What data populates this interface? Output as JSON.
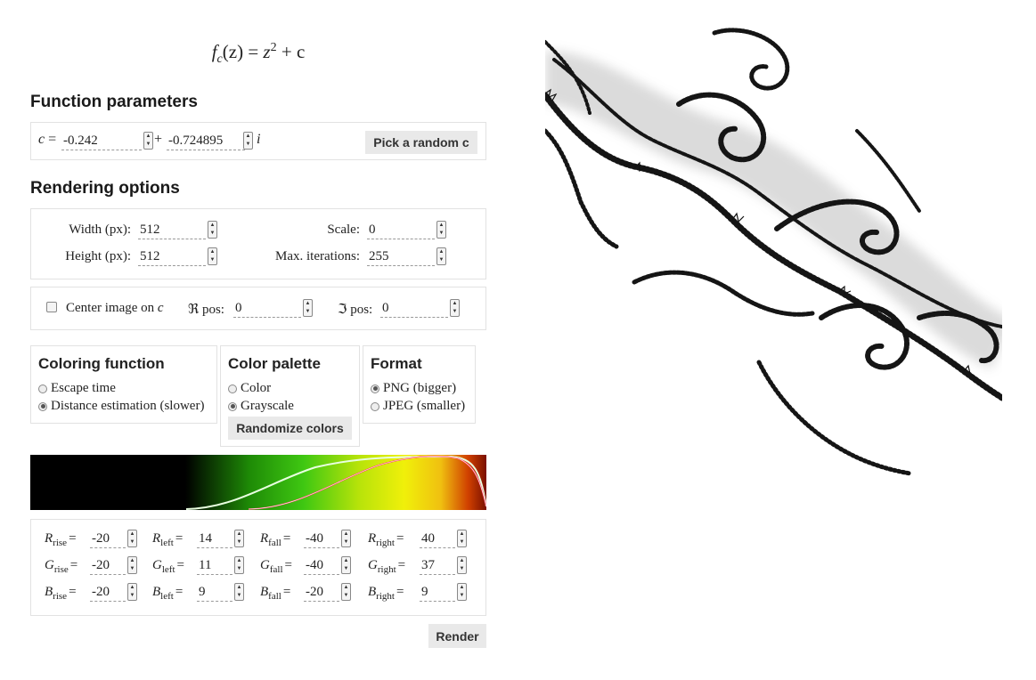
{
  "formula": {
    "f": "f",
    "sub": "c",
    "z": "(z)",
    "eq": " = ",
    "z2": "z",
    "pow": "2",
    "plus": " + c"
  },
  "function_parameters": {
    "title": "Function parameters",
    "c_label": "c",
    "eq": "=",
    "real": "-0.242",
    "plus": "+",
    "imag": "-0.724895",
    "i": "i",
    "random_button": "Pick a random c"
  },
  "rendering_options": {
    "title": "Rendering options",
    "width_label": "Width (px):",
    "width_value": "512",
    "height_label": "Height (px):",
    "height_value": "512",
    "scale_label": "Scale:",
    "scale_value": "0",
    "maxiter_label": "Max. iterations:",
    "maxiter_value": "255",
    "center_label": "Center image on",
    "center_c": "c",
    "re_label": "ℜ pos:",
    "re_value": "0",
    "im_label": "ℑ pos:",
    "im_value": "0"
  },
  "coloring_function": {
    "title": "Coloring function",
    "options": [
      {
        "label": "Escape time",
        "selected": false
      },
      {
        "label": "Distance estimation (slower)",
        "selected": true
      }
    ]
  },
  "color_palette": {
    "title": "Color palette",
    "options": [
      {
        "label": "Color",
        "selected": false
      },
      {
        "label": "Grayscale",
        "selected": true
      }
    ],
    "randomize_button": "Randomize colors"
  },
  "format": {
    "title": "Format",
    "options": [
      {
        "label": "PNG (bigger)",
        "selected": true
      },
      {
        "label": "JPEG (smaller)",
        "selected": false
      }
    ]
  },
  "gradient_params": {
    "eq": "=",
    "rows": [
      {
        "ch": "R",
        "rise": "-20",
        "left": "14",
        "fall": "-40",
        "right": "40"
      },
      {
        "ch": "G",
        "rise": "-20",
        "left": "11",
        "fall": "-40",
        "right": "37"
      },
      {
        "ch": "B",
        "rise": "-20",
        "left": "9",
        "fall": "-20",
        "right": "9"
      }
    ],
    "subs": {
      "rise": "rise",
      "left": "left",
      "fall": "fall",
      "right": "right"
    }
  },
  "render_button": "Render",
  "colors": {
    "panel_border": "#e2e2e2",
    "button_bg": "#e9e9e9"
  }
}
